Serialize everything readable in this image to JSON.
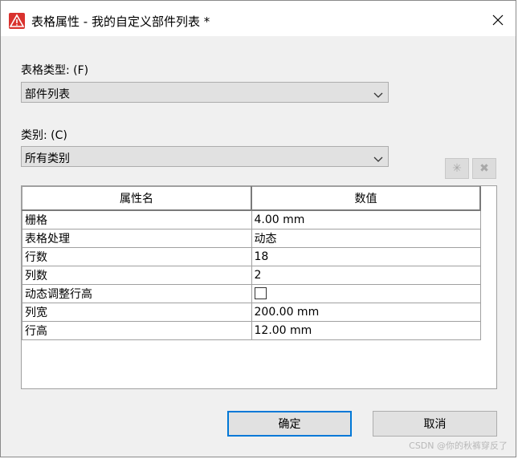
{
  "window": {
    "title": "表格属性 - 我的自定义部件列表 *",
    "close_glyph": "✕"
  },
  "table_type": {
    "label": "表格类型: (F)",
    "value": "部件列表"
  },
  "category": {
    "label": "类别: (C)",
    "value": "所有类别"
  },
  "toolbar": {
    "add_glyph": "✳",
    "delete_glyph": "✖"
  },
  "grid": {
    "headers": [
      "属性名",
      "数值"
    ],
    "rows": [
      {
        "name": "栅格",
        "value": "4.00 mm"
      },
      {
        "name": "表格处理",
        "value": "动态"
      },
      {
        "name": "行数",
        "value": "18"
      },
      {
        "name": "列数",
        "value": "2"
      },
      {
        "name": "动态调整行高",
        "value": ""
      },
      {
        "name": "列宽",
        "value": "200.00 mm"
      },
      {
        "name": "行高",
        "value": "12.00 mm"
      }
    ]
  },
  "buttons": {
    "ok": "确定",
    "cancel": "取消"
  },
  "watermark": "CSDN @你的秋裤穿反了",
  "colors": {
    "accent": "#0078d7",
    "icon_red": "#d9322e",
    "dialog_bg": "#f0f0f0"
  }
}
